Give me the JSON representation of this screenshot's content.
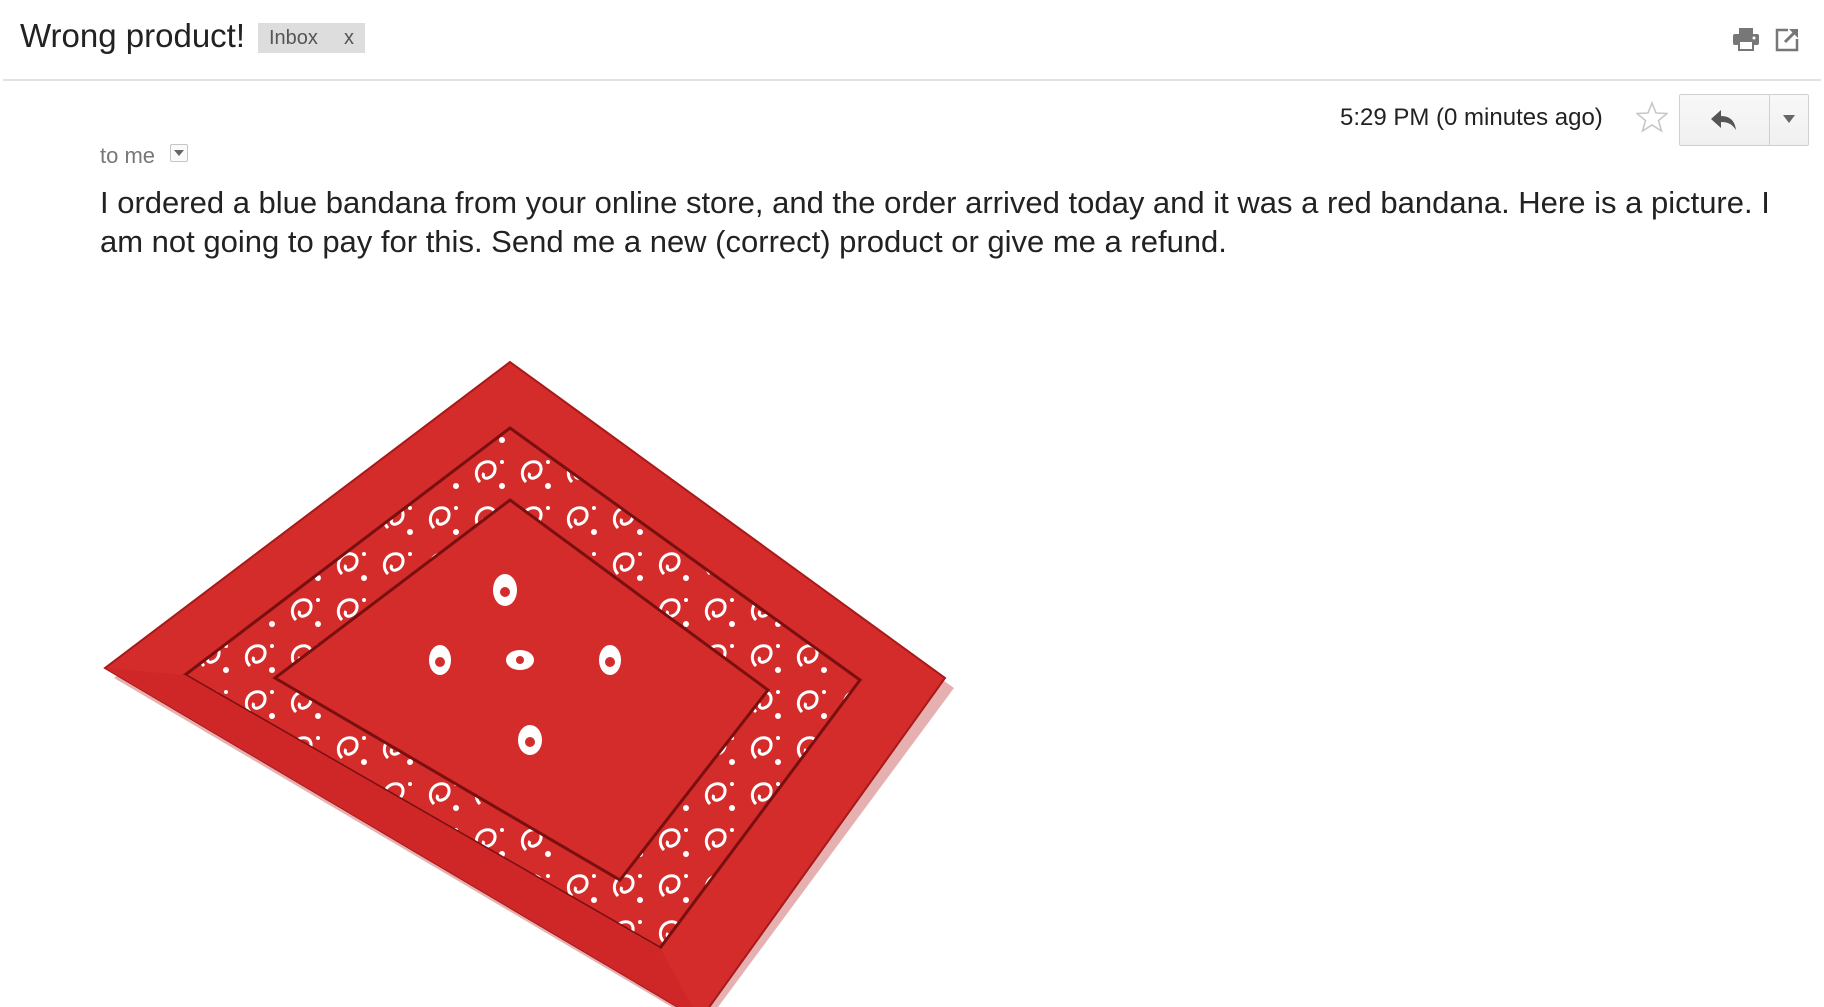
{
  "email": {
    "subject": "Wrong product!",
    "label": "Inbox",
    "label_close": "x",
    "timestamp": "5:29 PM (0 minutes ago)",
    "recipient": "to me",
    "body": "I ordered a blue bandana from your online store, and the order arrived today and it was a red bandana. Here is a picture. I am not going to pay for this. Send me a new (correct) product or give me a refund."
  },
  "icons": {
    "print": "print-icon",
    "new_window": "new-window-icon",
    "star": "star-icon",
    "reply": "reply-icon",
    "more": "chevron-down-icon"
  },
  "attachment": {
    "subject": "red bandana",
    "color": "#d42b2b"
  }
}
